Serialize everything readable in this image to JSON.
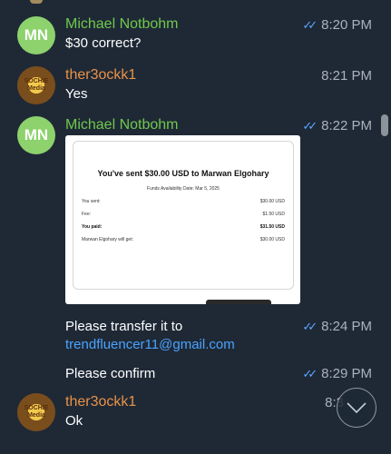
{
  "messages": [
    {
      "sender": "Michael Notbohm",
      "avatar": "MN",
      "text": "$30 correct?",
      "time": "8:20 PM",
      "read_check": "✓✓"
    },
    {
      "sender": "ther3ockk1",
      "avatar_logo": "SOCHIE Media",
      "text": "Yes",
      "time": "8:21 PM"
    },
    {
      "sender": "Michael Notbohm",
      "avatar": "MN",
      "time": "8:22 PM",
      "read_check": "✓✓",
      "receipt": {
        "title": "You've sent $30.00 USD to Marwan Elgohary",
        "funds_date": "Funds Availability Date: Mar 5, 2025",
        "rows": [
          {
            "label": "You sent:",
            "value": "$30.00 USD"
          },
          {
            "label": "Fee:",
            "value": "$1.50 USD"
          },
          {
            "label": "You paid:",
            "value": "$31.50 USD"
          },
          {
            "label": "Marwan Elgohary will get:",
            "value": "$30.00 USD"
          }
        ]
      }
    },
    {
      "text_line1": "Please transfer it to",
      "email": "trendfluencer11@gmail.com",
      "time": "8:24 PM",
      "read_check": "✓✓"
    },
    {
      "text": "Please confirm",
      "time": "8:29 PM",
      "read_check": "✓✓"
    },
    {
      "sender": "ther3ockk1",
      "avatar_logo": "SOCHIE Media",
      "text": "Ok",
      "time_partial": "8:3"
    }
  ],
  "icons": {
    "scroll_down": "chevron-down-icon"
  },
  "colors": {
    "background": "#1f2936",
    "sender_green": "#6fc94d",
    "sender_orange": "#e99247",
    "link": "#4aa3ff",
    "check": "#5aa6ff"
  }
}
